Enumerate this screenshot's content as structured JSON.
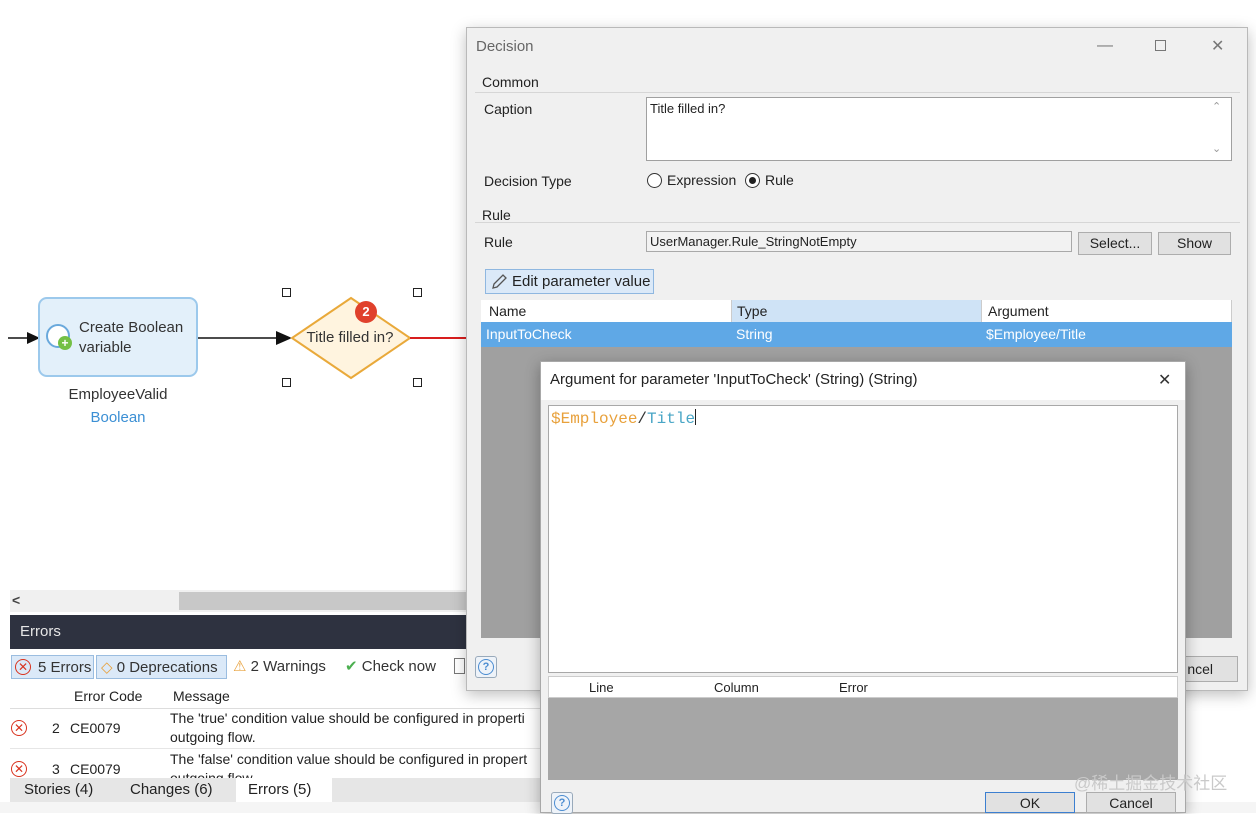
{
  "canvas": {
    "activity_label": "Create Boolean variable",
    "variable_name": "EmployeeValid",
    "variable_type": "Boolean",
    "decision_label": "Title filled in?",
    "decision_badge": "2"
  },
  "errors_pane": {
    "title": "Errors",
    "toolbar": {
      "errors": "5 Errors",
      "deprecations": "0 Deprecations",
      "warnings": "2 Warnings",
      "check_now": "Check now"
    },
    "columns": [
      "Error Code",
      "Message"
    ],
    "rows": [
      {
        "num": "2",
        "code": "CE0079",
        "message": "The 'true' condition value should be configured in properti",
        "message2": "outgoing flow."
      },
      {
        "num": "3",
        "code": "CE0079",
        "message": "The 'false' condition value should be configured in propert",
        "message2": "outgoing flow."
      }
    ],
    "hscroll_arrow": "<"
  },
  "bottom_tabs": [
    "Stories (4)",
    "Changes (6)",
    "Errors (5)"
  ],
  "decision_dialog": {
    "title": "Decision",
    "section_common": "Common",
    "caption_label": "Caption",
    "caption_value": "Title filled in?",
    "decision_type_label": "Decision Type",
    "option_expression": "Expression",
    "option_rule": "Rule",
    "section_rule": "Rule",
    "rule_label": "Rule",
    "rule_value": "UserManager.Rule_StringNotEmpty",
    "select_button": "Select...",
    "show_button": "Show",
    "edit_parameter_button": "Edit parameter value",
    "grid_columns": [
      "Name",
      "Type",
      "Argument"
    ],
    "grid_row": {
      "name": "InputToCheck",
      "type": "String",
      "argument": "$Employee/Title"
    },
    "cancel_button_partial": "ncel"
  },
  "argument_dialog": {
    "title": "Argument for parameter 'InputToCheck' (String) (String)",
    "expression_var": "$Employee",
    "expression_slash": "/",
    "expression_attr": "Title",
    "error_columns": [
      "Line",
      "Column",
      "Error"
    ],
    "ok_button": "OK",
    "cancel_button": "Cancel"
  },
  "watermark": "@稀土掘金技术社区"
}
